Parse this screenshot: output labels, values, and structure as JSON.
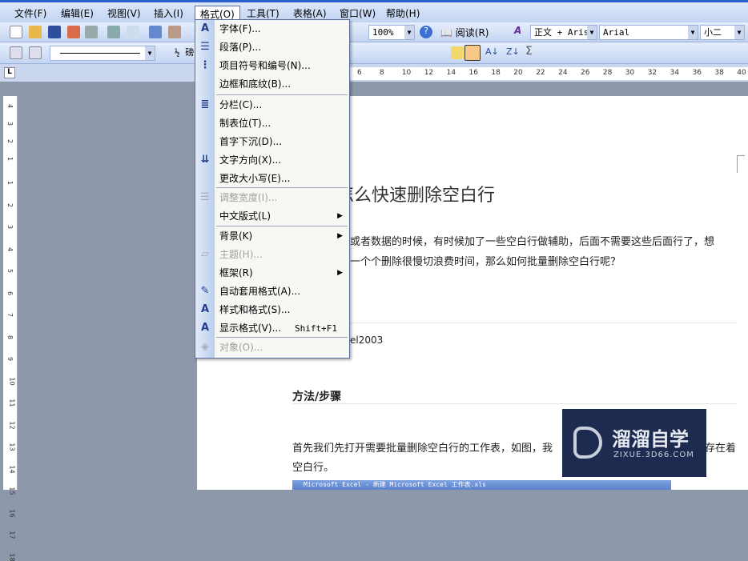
{
  "menubar": [
    "文件(F)",
    "编辑(E)",
    "视图(V)",
    "插入(I)",
    "格式(O)",
    "工具(T)",
    "表格(A)",
    "窗口(W)",
    "帮助(H)"
  ],
  "toolbar": {
    "zoom": "100%",
    "read": "阅读(R)",
    "style": "正文 + Aris",
    "font": "Arial",
    "size": "小二",
    "line_weight": "½ 磅"
  },
  "ruler": [
    "6",
    "8",
    "10",
    "12",
    "14",
    "16",
    "18",
    "20",
    "22",
    "24",
    "26",
    "28",
    "30",
    "32",
    "34",
    "36",
    "38",
    "40"
  ],
  "vruler": [
    "4",
    "3",
    "2",
    "1",
    "1",
    "2",
    "3",
    "4",
    "5",
    "6",
    "7",
    "8",
    "9",
    "10",
    "11",
    "12",
    "13",
    "14",
    "15",
    "16",
    "17",
    "18"
  ],
  "format_menu": [
    {
      "label": "字体(F)...",
      "icon": "font-icon"
    },
    {
      "label": "段落(P)...",
      "icon": "paragraph-icon"
    },
    {
      "label": "项目符号和编号(N)...",
      "icon": "bullets-icon"
    },
    {
      "label": "边框和底纹(B)...",
      "icon": ""
    },
    {
      "label": "分栏(C)...",
      "icon": "columns-icon"
    },
    {
      "label": "制表位(T)...",
      "icon": ""
    },
    {
      "label": "首字下沉(D)...",
      "icon": ""
    },
    {
      "label": "文字方向(X)...",
      "icon": "text-direction-icon"
    },
    {
      "label": "更改大小写(E)...",
      "icon": ""
    },
    {
      "label": "调整宽度(I)...",
      "icon": "fit-width-icon",
      "disabled": true
    },
    {
      "label": "中文版式(L)",
      "icon": "",
      "submenu": true
    },
    {
      "label": "背景(K)",
      "icon": "",
      "submenu": true
    },
    {
      "label": "主题(H)...",
      "icon": "theme-icon",
      "disabled": true
    },
    {
      "label": "框架(R)",
      "icon": "",
      "submenu": true
    },
    {
      "label": "自动套用格式(A)...",
      "icon": "autoformat-icon"
    },
    {
      "label": "样式和格式(S)...",
      "icon": "styles-icon"
    },
    {
      "label": "显示格式(V)...",
      "icon": "reveal-format-icon",
      "shortcut": "Shift+F1"
    },
    {
      "label": "对象(O)...",
      "icon": "object-icon",
      "disabled": true
    }
  ],
  "doc": {
    "title": "怎么快速删除空白行",
    "p1a": "或者数据的时候，有时候加了一些空白行做辅助，后面不需要这些后面行了，想",
    "p1b": "一个个删除很慢切浪费时间，那么如何批量删除空白行呢？",
    "tool": "el2003",
    "steps": "方法/步骤",
    "p2a": "首先我们先打开需要批量删除空白行的工作表，如图，我",
    "p2a_end": "存在着",
    "p2b": "空白行。",
    "excel_title": "Microsoft Excel - 新建 Microsoft Excel 工作表.xls"
  },
  "watermark": {
    "name": "溜溜自学",
    "url": "ZIXUE.3D66.COM"
  }
}
